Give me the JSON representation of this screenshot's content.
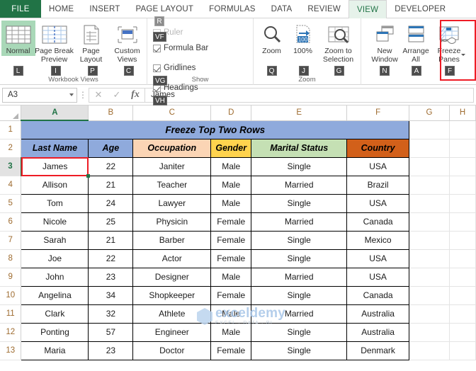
{
  "ribbon": {
    "file_tab": "FILE",
    "tabs": [
      {
        "label": "HOME",
        "active": false
      },
      {
        "label": "INSERT",
        "active": false
      },
      {
        "label": "PAGE LAYOUT",
        "active": false
      },
      {
        "label": "FORMULAS",
        "active": false
      },
      {
        "label": "DATA",
        "active": false
      },
      {
        "label": "REVIEW",
        "active": false
      },
      {
        "label": "VIEW",
        "active": true
      },
      {
        "label": "DEVELOPER",
        "active": false
      }
    ],
    "groups": {
      "workbook_views": {
        "label": "Workbook Views",
        "buttons": [
          {
            "label": "Normal",
            "keytip": "L",
            "selected": true
          },
          {
            "label": "Page Break Preview",
            "keytip": "I",
            "selected": false
          },
          {
            "label": "Page Layout",
            "keytip": "P",
            "selected": false
          },
          {
            "label": "Custom Views",
            "keytip": "C",
            "selected": false
          }
        ]
      },
      "show": {
        "label": "Show",
        "items": [
          {
            "label": "Ruler",
            "checked": true,
            "disabled": true,
            "keytip": "R"
          },
          {
            "label": "Formula Bar",
            "checked": true,
            "disabled": false,
            "keytip": "VF"
          },
          {
            "label": "Gridlines",
            "checked": true,
            "disabled": false,
            "keytip": "VG"
          },
          {
            "label": "Headings",
            "checked": true,
            "disabled": false,
            "keytip": "VH"
          }
        ]
      },
      "zoom": {
        "label": "Zoom",
        "buttons": [
          {
            "label": "Zoom",
            "keytip": "Q"
          },
          {
            "label": "100%",
            "keytip": "J"
          },
          {
            "label": "Zoom to Selection",
            "keytip": "G"
          }
        ]
      },
      "window": {
        "label": "",
        "buttons": [
          {
            "label": "New Window",
            "keytip": "N"
          },
          {
            "label": "Arrange All",
            "keytip": "A"
          },
          {
            "label": "Freeze Panes",
            "keytip": "F",
            "highlighted": true
          }
        ]
      }
    }
  },
  "formula_bar": {
    "name_box_value": "A3",
    "cancel_icon": "✕",
    "enter_icon": "✓",
    "function_icon": "fx",
    "formula_value": "James"
  },
  "sheet": {
    "columns": [
      "A",
      "B",
      "C",
      "D",
      "E",
      "F",
      "G",
      "H"
    ],
    "active_column": "A",
    "active_row": "3",
    "row_numbers": [
      "1",
      "2",
      "3",
      "4",
      "5",
      "6",
      "7",
      "8",
      "9",
      "10",
      "11",
      "12",
      "13"
    ],
    "title_row": {
      "row": "1",
      "text": "Freeze Top Two Rows"
    },
    "header_row": {
      "row": "2",
      "cells": [
        {
          "text": "Last Name",
          "color": "#8faadc"
        },
        {
          "text": "Age",
          "color": "#8faadc"
        },
        {
          "text": "Occupation",
          "color": "#fbd5b5"
        },
        {
          "text": "Gender",
          "color": "#ffd34e"
        },
        {
          "text": "Marital Status",
          "color": "#c5e0b4"
        },
        {
          "text": "Country",
          "color": "#d2601a"
        }
      ]
    },
    "rows": [
      {
        "row": "3",
        "cells": [
          "James",
          "22",
          "Janiter",
          "Male",
          "Single",
          "USA"
        ]
      },
      {
        "row": "4",
        "cells": [
          "Allison",
          "21",
          "Teacher",
          "Male",
          "Married",
          "Brazil"
        ]
      },
      {
        "row": "5",
        "cells": [
          "Tom",
          "24",
          "Lawyer",
          "Male",
          "Single",
          "USA"
        ]
      },
      {
        "row": "6",
        "cells": [
          "Nicole",
          "25",
          "Physicin",
          "Female",
          "Married",
          "Canada"
        ]
      },
      {
        "row": "7",
        "cells": [
          "Sarah",
          "21",
          "Barber",
          "Female",
          "Single",
          "Mexico"
        ]
      },
      {
        "row": "8",
        "cells": [
          "Joe",
          "22",
          "Actor",
          "Female",
          "Single",
          "USA"
        ]
      },
      {
        "row": "9",
        "cells": [
          "John",
          "23",
          "Designer",
          "Male",
          "Married",
          "USA"
        ]
      },
      {
        "row": "10",
        "cells": [
          "Angelina",
          "34",
          "Shopkeeper",
          "Female",
          "Single",
          "Canada"
        ]
      },
      {
        "row": "11",
        "cells": [
          "Clark",
          "32",
          "Athlete",
          "Male",
          "Married",
          "Australia"
        ]
      },
      {
        "row": "12",
        "cells": [
          "Ponting",
          "57",
          "Engineer",
          "Male",
          "Single",
          "Australia"
        ]
      },
      {
        "row": "13",
        "cells": [
          "Maria",
          "23",
          "Doctor",
          "Female",
          "Single",
          "Denmark"
        ]
      }
    ],
    "selected_cell": "A3"
  },
  "watermark": {
    "main": "exceldemy",
    "sub": "EXCEL · DATA · BI"
  },
  "colors": {
    "file_tab_green": "#217346",
    "active_tab_bg": "#e6f2ea",
    "annotation_red": "#ee1c25",
    "selection_green": "#217346"
  }
}
